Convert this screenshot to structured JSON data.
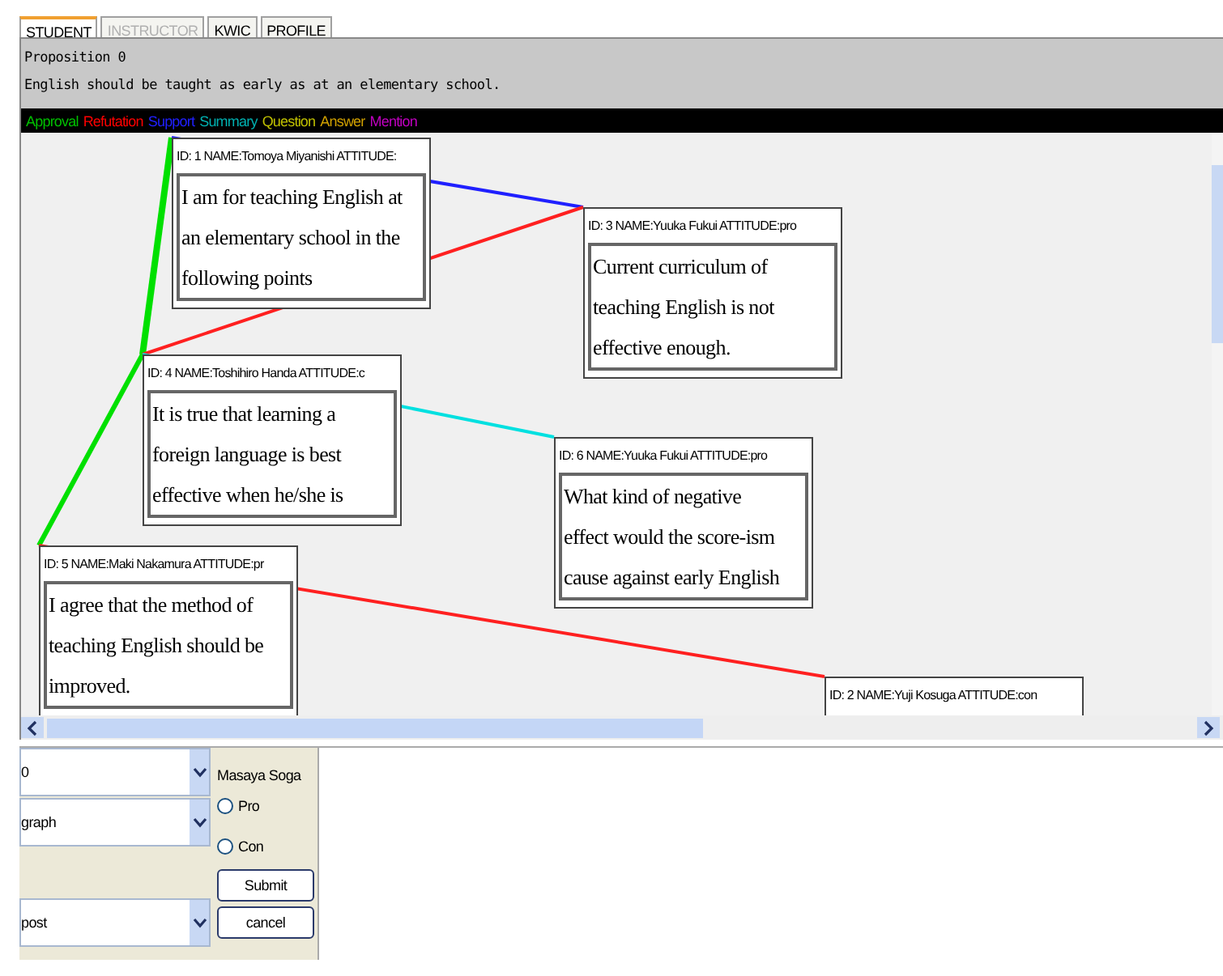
{
  "tabs": [
    {
      "label": "STUDENT",
      "selected": true,
      "disabled": false
    },
    {
      "label": "INSTRUCTOR",
      "selected": false,
      "disabled": true
    },
    {
      "label": "KWIC",
      "selected": false,
      "disabled": false
    },
    {
      "label": "PROFILE",
      "selected": false,
      "disabled": false
    }
  ],
  "proposition": {
    "title": "Proposition  0",
    "text": "English should be taught as early as at an elementary school."
  },
  "legend": [
    {
      "label": "Approval",
      "color": "#00c000"
    },
    {
      "label": "Refutation",
      "color": "#ff0000"
    },
    {
      "label": "Support",
      "color": "#2020ff"
    },
    {
      "label": "Summary",
      "color": "#00b0b0"
    },
    {
      "label": "Question",
      "color": "#c0c000"
    },
    {
      "label": "Answer",
      "color": "#d0a000"
    },
    {
      "label": "Mention",
      "color": "#c000c0"
    }
  ],
  "nodes": [
    {
      "header": "ID: 1 NAME:Tomoya Miyanishi ATTITUDE:",
      "lines": [
        "I am for teaching English at",
        "an elementary school in the",
        "following points"
      ]
    },
    {
      "header": "ID: 3 NAME:Yuuka Fukui ATTITUDE:pro",
      "lines": [
        "Current curriculum of",
        "teaching English is not",
        "effective enough."
      ]
    },
    {
      "header": "ID: 4 NAME:Toshihiro Handa ATTITUDE:c",
      "lines": [
        "It is true that learning a",
        "foreign language is best",
        "effective when he/she is"
      ]
    },
    {
      "header": "ID: 6 NAME:Yuuka Fukui ATTITUDE:pro",
      "lines": [
        "What kind of negative",
        "effect would the score-ism",
        "cause against early English"
      ]
    },
    {
      "header": "ID: 5 NAME:Maki Nakamura ATTITUDE:pr",
      "lines": [
        "I agree that the method of",
        "teaching English should be",
        "improved."
      ]
    },
    {
      "header": "ID: 2 NAME:Yuji Kosuga ATTITUDE:con"
    }
  ],
  "edges": [
    {
      "color": "#00e000"
    },
    {
      "color": "#00e000"
    },
    {
      "color": "#2020ff"
    },
    {
      "color": "#ff2020"
    },
    {
      "color": "#00e0e0"
    },
    {
      "color": "#ff2020"
    }
  ],
  "controls": {
    "selects": [
      {
        "value": "0"
      },
      {
        "value": "graph"
      },
      {
        "value": "post"
      }
    ],
    "user": "Masaya Soga",
    "radios": [
      {
        "label": "Pro",
        "selected": false
      },
      {
        "label": "Con",
        "selected": false
      }
    ],
    "buttons": [
      "Submit",
      "cancel"
    ]
  }
}
